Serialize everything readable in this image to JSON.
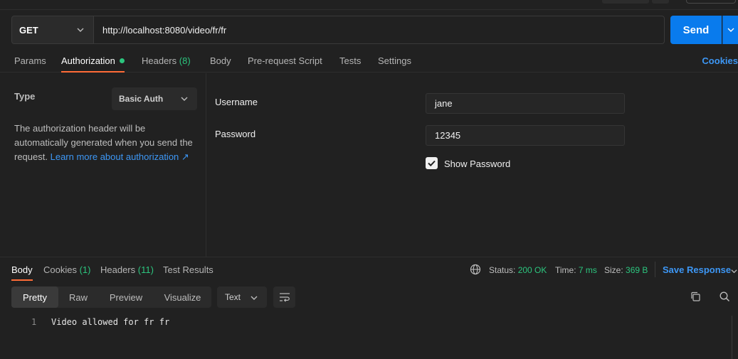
{
  "request": {
    "method": "GET",
    "url": "http://localhost:8080/video/fr/fr",
    "send_label": "Send"
  },
  "request_tabs": [
    {
      "label": "Params"
    },
    {
      "label": "Authorization"
    },
    {
      "label": "Headers",
      "count": "(8)"
    },
    {
      "label": "Body"
    },
    {
      "label": "Pre-request Script"
    },
    {
      "label": "Tests"
    },
    {
      "label": "Settings"
    }
  ],
  "cookies_link": "Cookies",
  "auth": {
    "type_label": "Type",
    "type_value": "Basic Auth",
    "description": "The authorization header will be automatically generated when you send the request.",
    "learn_more": "Learn more about authorization ↗",
    "username_label": "Username",
    "username_value": "jane",
    "password_label": "Password",
    "password_value": "12345",
    "show_password_label": "Show Password",
    "show_password_checked": true
  },
  "response": {
    "tabs": [
      {
        "label": "Body"
      },
      {
        "label": "Cookies",
        "count": "(1)"
      },
      {
        "label": "Headers",
        "count": "(11)"
      },
      {
        "label": "Test Results"
      }
    ],
    "status_label": "Status:",
    "status_value": "200 OK",
    "time_label": "Time:",
    "time_value": "7 ms",
    "size_label": "Size:",
    "size_value": "369 B",
    "save_label": "Save Response",
    "views": [
      "Pretty",
      "Raw",
      "Preview",
      "Visualize"
    ],
    "format": "Text",
    "lines": [
      {
        "number": "1",
        "text": "Video allowed for fr fr"
      }
    ]
  },
  "colors": {
    "accent": "#ff6c37",
    "send": "#097bed",
    "success": "#2cc57e",
    "link": "#3d97f5"
  },
  "icons": [
    "chevron-down-icon",
    "globe-icon",
    "wrap-lines-icon",
    "copy-icon",
    "search-icon",
    "check-icon",
    "external-link-icon"
  ]
}
